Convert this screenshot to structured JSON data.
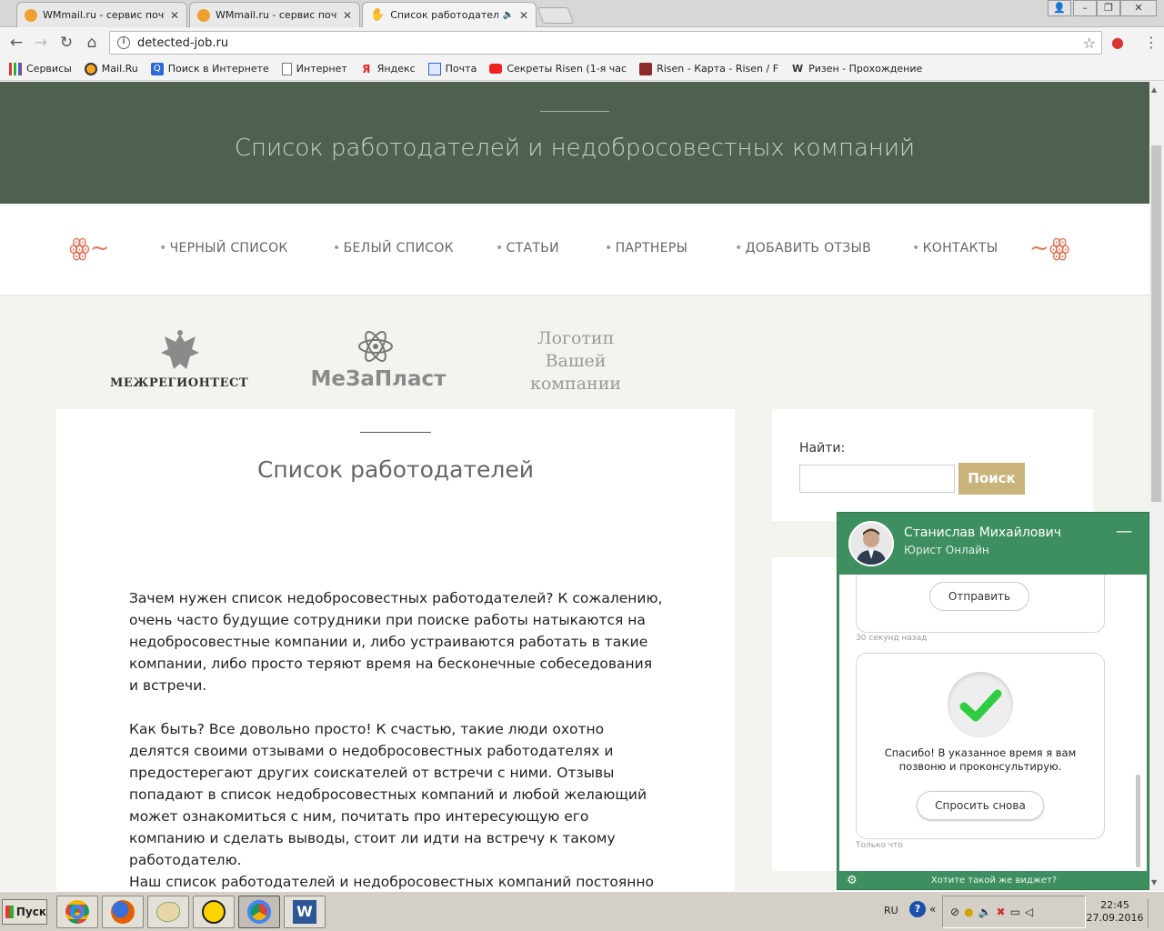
{
  "browser": {
    "tabs": [
      {
        "title": "WMmail.ru - сервис почтов"
      },
      {
        "title": "WMmail.ru - сервис почтов"
      },
      {
        "title": "Список работодателей"
      }
    ],
    "url": "detected-job.ru",
    "bookmarks": [
      {
        "label": "Сервисы",
        "icon": "apps-grid-icon"
      },
      {
        "label": "Mail.Ru",
        "icon": "mailru-icon"
      },
      {
        "label": "Поиск в Интернете",
        "icon": "search-icon"
      },
      {
        "label": "Интернет",
        "icon": "page-icon"
      },
      {
        "label": "Яндекс",
        "icon": "yandex-icon"
      },
      {
        "label": "Почта",
        "icon": "mail-icon"
      },
      {
        "label": "Секреты Risen (1-я час",
        "icon": "youtube-icon"
      },
      {
        "label": "Risen - Карта - Risen / F",
        "icon": "rpg-icon"
      },
      {
        "label": "Ризен - Прохождение",
        "icon": "w-icon"
      }
    ]
  },
  "page": {
    "hero_title": "Список работодателей и недобросовестных компаний",
    "nav": [
      "ЧЕРНЫЙ СПИСОК",
      "БЕЛЫЙ СПИСОК",
      "СТАТЬИ",
      "ПАРТНЕРЫ",
      "ДОБАВИТЬ ОТЗЫВ",
      "КОНТАКТЫ"
    ],
    "logos": {
      "logo1": "МЕЖРЕГИОНТЕСТ",
      "logo2": "МеЗаПласт",
      "logo3": [
        "Логотип",
        "Вашей",
        "компании"
      ]
    },
    "content_title": "Список работодателей",
    "paragraphs": [
      "Зачем нужен список недобросовестных работодателей? К сожалению, очень часто будущие сотрудники при поиске работы натыкаются на недобросовестные компании и, либо устраиваются работать в такие компании, либо просто теряют время на бесконечные собеседования и встречи.",
      "Как быть? Все довольно просто! К счастью, такие люди охотно делятся своими отзывами о недобросовестных работодателях и предостерегают других соискателей от встречи с ними. Отзывы попадают в список недобросовестных компаний и любой желающий может ознакомиться с ним, почитать про интересующую его компанию и сделать выводы, стоит ли идти на встречу к такому работодателю.",
      "Наш список работодателей и недобросовестных компаний постоянно"
    ],
    "search": {
      "label": "Найти:",
      "value": "",
      "button": "Поиск"
    }
  },
  "chat": {
    "name": "Станислав Михайлович",
    "role": "Юрист Онлайн",
    "send_button": "Отправить",
    "time1": "30 секунд назад",
    "thanks": "Спасибо! В указанное время я вам позвоню и проконсультирую.",
    "ask_again": "Спросить снова",
    "time2": "Только что",
    "footer": "Хотите такой же виджет?"
  },
  "taskbar": {
    "start": "Пуск",
    "lang": "RU",
    "time": "22:45",
    "date": "27.09.2016"
  },
  "colors": {
    "hero": "#4e6150",
    "accent": "#c9b37a",
    "chat": "#3e8f5f",
    "ornament": "#e07a5f"
  }
}
